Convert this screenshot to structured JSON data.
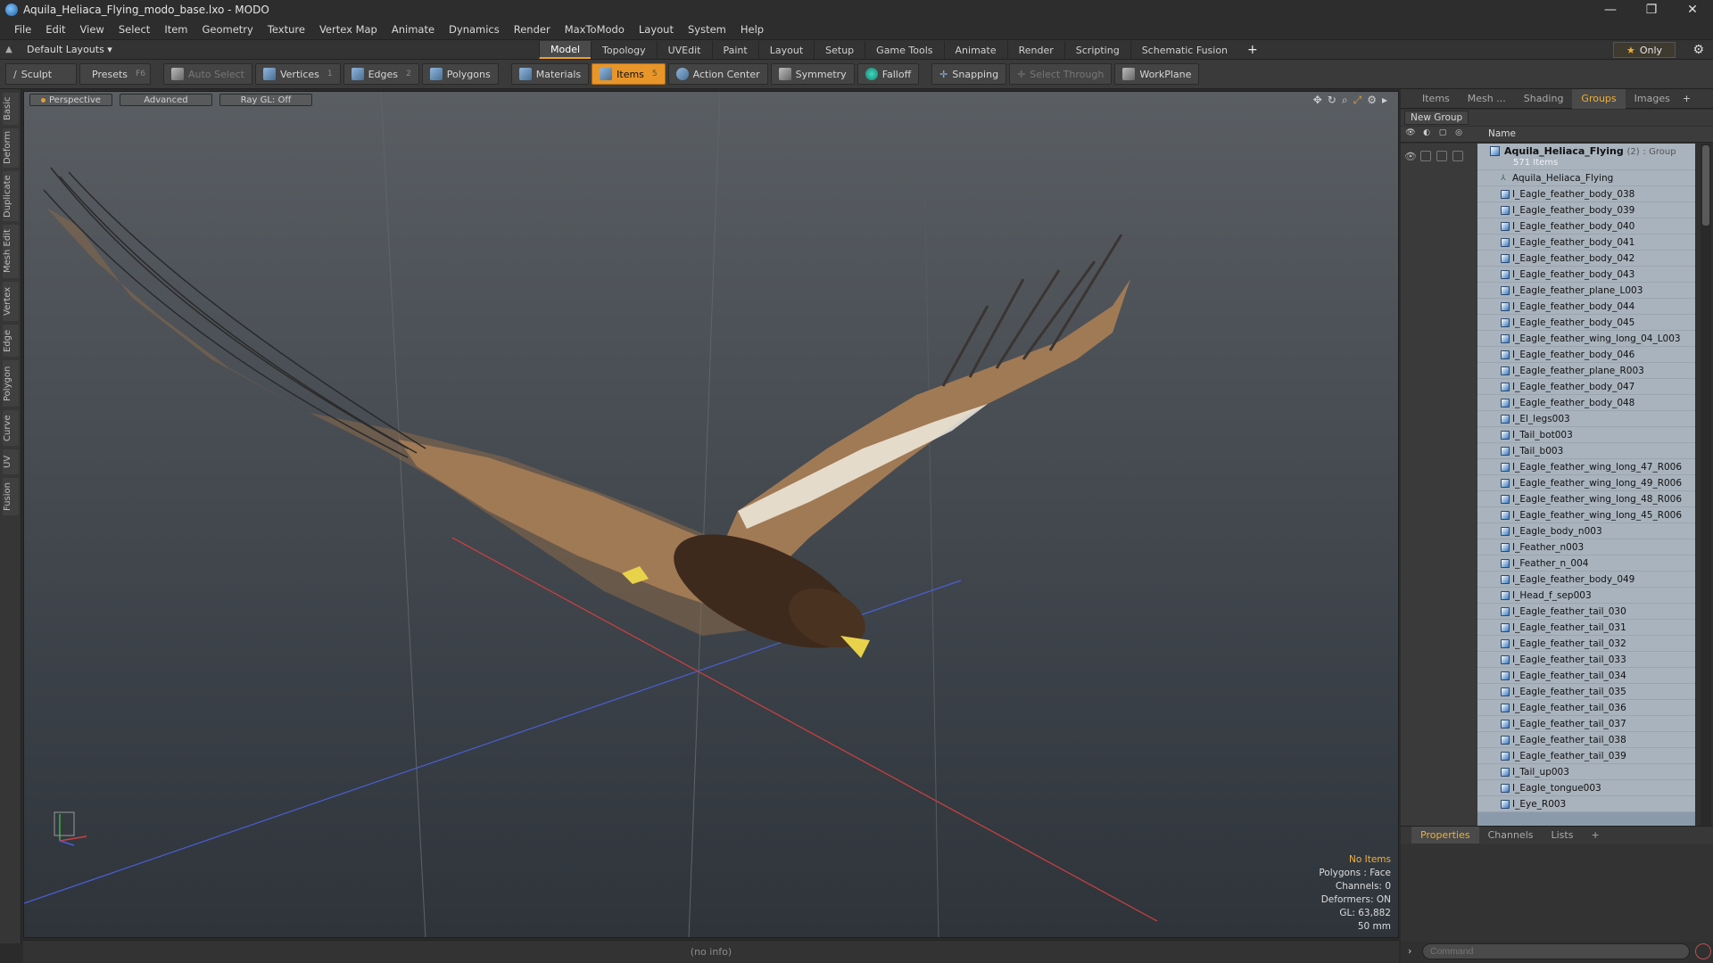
{
  "window": {
    "title": "Aquila_Heliaca_Flying_modo_base.lxo - MODO",
    "controls": [
      "—",
      "❐",
      "✕"
    ]
  },
  "menu": [
    "File",
    "Edit",
    "View",
    "Select",
    "Item",
    "Geometry",
    "Texture",
    "Vertex Map",
    "Animate",
    "Dynamics",
    "Render",
    "MaxToModo",
    "Layout",
    "System",
    "Help"
  ],
  "layout": {
    "select": "Default Layouts ▾",
    "tabs": [
      "Model",
      "Topology",
      "UVEdit",
      "Paint",
      "Layout",
      "Setup",
      "Game Tools",
      "Animate",
      "Render",
      "Scripting",
      "Schematic Fusion"
    ],
    "active_tab": "Model",
    "add": "+",
    "only": "Only"
  },
  "toolbar": {
    "sculpt": "Sculpt",
    "presets": "Presets",
    "presets_key": "F6",
    "auto_select": "Auto Select",
    "vertices": "Vertices",
    "vertices_key": "1",
    "edges": "Edges",
    "edges_key": "2",
    "polygons": "Polygons",
    "materials": "Materials",
    "items": "Items",
    "items_key": "5",
    "action_center": "Action Center",
    "symmetry": "Symmetry",
    "falloff": "Falloff",
    "snapping": "Snapping",
    "select_through": "Select Through",
    "workplane": "WorkPlane"
  },
  "left_tabs": [
    "Basic",
    "Deform",
    "Duplicate",
    "Mesh Edit",
    "Vertex",
    "Edge",
    "Polygon",
    "Curve",
    "UV",
    "Fusion"
  ],
  "viewport": {
    "perspective": "Perspective",
    "advanced": "Advanced",
    "raygl": "Ray GL: Off",
    "info": {
      "no_items": "No Items",
      "polygons": "Polygons : Face",
      "channels": "Channels: 0",
      "deformers": "Deformers: ON",
      "gl": "GL: 63,882",
      "focal": "50 mm"
    }
  },
  "status": "(no info)",
  "right_panel": {
    "tabs": [
      "Items",
      "Mesh ...",
      "Shading",
      "Groups",
      "Images"
    ],
    "active_tab": "Groups",
    "new_group": "New Group",
    "name_header": "Name",
    "group": {
      "name": "Aquila_Heliaca_Flying",
      "count": "(2)",
      "type": ": Group",
      "items": "571 Items"
    },
    "locator": "Aquila_Heliaca_Flying",
    "items": [
      "I_Eagle_feather_body_038",
      "I_Eagle_feather_body_039",
      "I_Eagle_feather_body_040",
      "I_Eagle_feather_body_041",
      "I_Eagle_feather_body_042",
      "I_Eagle_feather_body_043",
      "I_Eagle_feather_plane_L003",
      "I_Eagle_feather_body_044",
      "I_Eagle_feather_body_045",
      "I_Eagle_feather_wing_long_04_L003",
      "I_Eagle_feather_body_046",
      "I_Eagle_feather_plane_R003",
      "I_Eagle_feather_body_047",
      "I_Eagle_feather_body_048",
      "I_El_legs003",
      "I_Tail_bot003",
      "I_Tail_b003",
      "I_Eagle_feather_wing_long_47_R006",
      "I_Eagle_feather_wing_long_49_R006",
      "I_Eagle_feather_wing_long_48_R006",
      "I_Eagle_feather_wing_long_45_R006",
      "I_Eagle_body_n003",
      "I_Feather_n003",
      "I_Feather_n_004",
      "I_Eagle_feather_body_049",
      "I_Head_f_sep003",
      "I_Eagle_feather_tail_030",
      "I_Eagle_feather_tail_031",
      "I_Eagle_feather_tail_032",
      "I_Eagle_feather_tail_033",
      "I_Eagle_feather_tail_034",
      "I_Eagle_feather_tail_035",
      "I_Eagle_feather_tail_036",
      "I_Eagle_feather_tail_037",
      "I_Eagle_feather_tail_038",
      "I_Eagle_feather_tail_039",
      "I_Tail_up003",
      "I_Eagle_tongue003",
      "I_Eye_R003"
    ],
    "props_tabs": [
      "Properties",
      "Channels",
      "Lists"
    ],
    "props_active": "Properties",
    "command_placeholder": "Command"
  },
  "colors": {
    "accent": "#e8952a",
    "highlight_text": "#f0b030",
    "list_bg": "#a9b3bd"
  }
}
